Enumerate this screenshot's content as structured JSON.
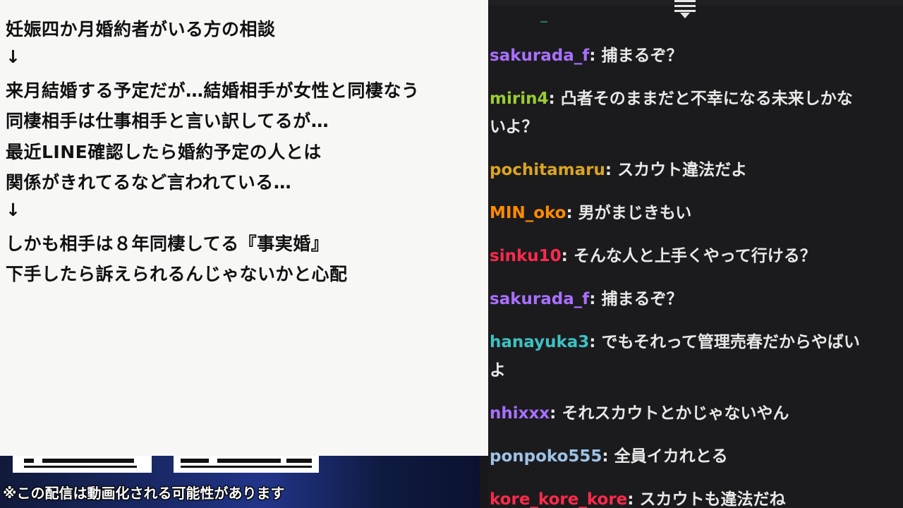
{
  "panel": {
    "lines": [
      "妊娠四か月婚約者がいる方の相談",
      "↓",
      "来月結婚する予定だが…結婚相手が女性と同棲なう",
      "同棲相手は仕事相手と言い訳してるが…",
      "最近LINE確認したら婚約予定の人とは",
      "関係がきれてるなど言われている…",
      "↓",
      "しかも相手は８年同棲してる『事実婚』",
      "下手したら訴えられるんじゃないかと心配"
    ]
  },
  "notice": "※この配信は動画化される可能性があります",
  "chat": {
    "messages": [
      {
        "user": "sakurada_f",
        "color": "#a970ff",
        "text": "捕まるぞ？"
      },
      {
        "user": "mirin4",
        "color": "#9acd32",
        "text": "凸者そのままだと不幸になる未来しかな",
        "text2": "いよ？"
      },
      {
        "user": "pochitamaru",
        "color": "#daa520",
        "text": "スカウト違法だよ"
      },
      {
        "user": "MIN_oko",
        "color": "#ff8c00",
        "text": "男がまじきもい"
      },
      {
        "user": "sinku10",
        "color": "#ff2a4a",
        "text": "そんな人と上手くやって行ける？"
      },
      {
        "user": "sakurada_f",
        "color": "#a970ff",
        "text": "捕まるぞ？"
      },
      {
        "user": "hanayuka3",
        "color": "#3ec1c1",
        "text": "でもそれって管理売春だからやばい",
        "text2": "よ"
      },
      {
        "user": "nhixxx",
        "color": "#a970ff",
        "text": "それスカウトとかじゃないやん"
      },
      {
        "user": "ponpoko555",
        "color": "#9ec3e6",
        "text": "全員イカれとる"
      },
      {
        "user": "kore_kore_kore",
        "color": "#ff2a4a",
        "text": "スカウトも違法だね"
      }
    ]
  }
}
